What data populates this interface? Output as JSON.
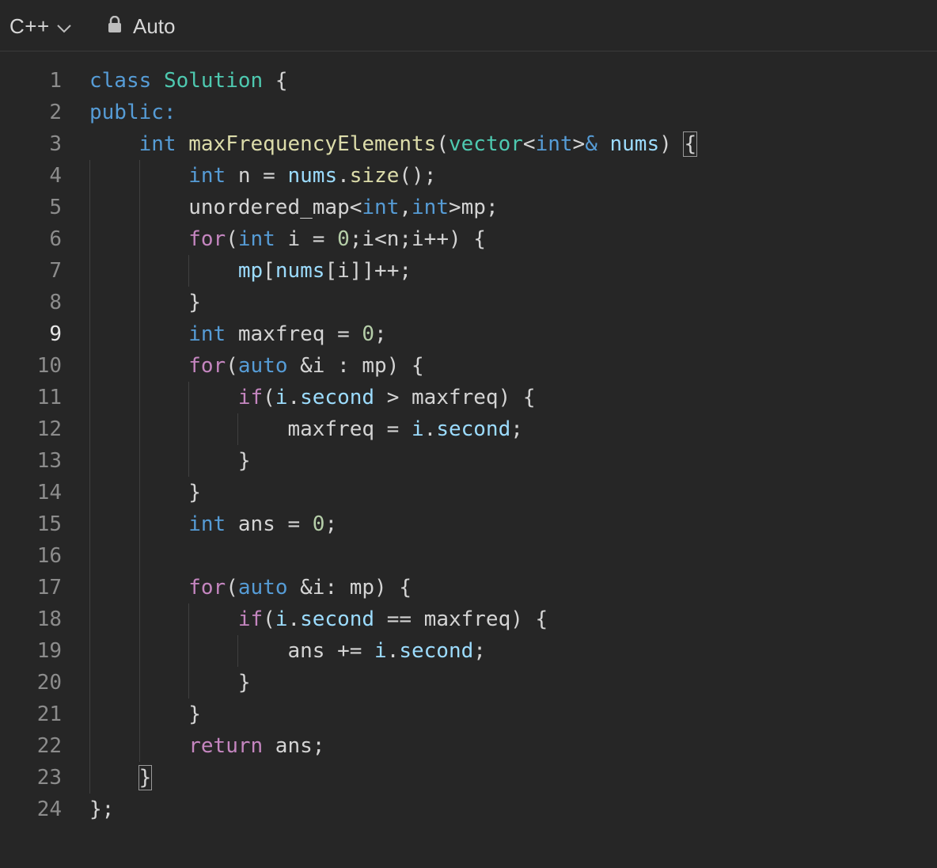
{
  "toolbar": {
    "language": "C++",
    "mode": "Auto",
    "icons": {
      "language_dropdown": "chevron-down-icon",
      "mode": "lock-icon"
    }
  },
  "editor": {
    "active_line": 9,
    "colors": {
      "background": "#262626",
      "keyword": "#569cd6",
      "control": "#c586c0",
      "type": "#4ec9b0",
      "function": "#dcdcaa",
      "variable": "#9cdcfe",
      "number": "#b5cea8",
      "text": "#d4d4d4"
    },
    "lines": [
      {
        "n": "1",
        "t": [
          [
            "class",
            "kw"
          ],
          [
            " ",
            ""
          ],
          [
            "Solution",
            "ty"
          ],
          [
            " {",
            ""
          ]
        ]
      },
      {
        "n": "2",
        "t": [
          [
            "public",
            "kw"
          ],
          [
            ":",
            "kw"
          ]
        ]
      },
      {
        "n": "3",
        "t": [
          [
            "    ",
            ""
          ],
          [
            "int",
            "kw"
          ],
          [
            " ",
            ""
          ],
          [
            "maxFrequencyElements",
            "fn"
          ],
          [
            "(",
            ""
          ],
          [
            "vector",
            "ty"
          ],
          [
            "<",
            ""
          ],
          [
            "int",
            "kw"
          ],
          [
            ">",
            ""
          ],
          [
            "&",
            "kw"
          ],
          [
            " ",
            ""
          ],
          [
            "nums",
            "var"
          ],
          [
            ") ",
            ""
          ],
          [
            "{",
            "bm"
          ]
        ]
      },
      {
        "n": "4",
        "t": [
          [
            "        ",
            ""
          ],
          [
            "int",
            "kw"
          ],
          [
            " n = ",
            ""
          ],
          [
            "nums",
            "var"
          ],
          [
            ".",
            ""
          ],
          [
            "size",
            "fn"
          ],
          [
            "();",
            ""
          ]
        ]
      },
      {
        "n": "5",
        "t": [
          [
            "        ",
            ""
          ],
          [
            "unordered_map<",
            ""
          ],
          [
            "int",
            "kw"
          ],
          [
            ",",
            ""
          ],
          [
            "int",
            "kw"
          ],
          [
            ">mp;",
            ""
          ]
        ]
      },
      {
        "n": "6",
        "t": [
          [
            "        ",
            ""
          ],
          [
            "for",
            "ctl"
          ],
          [
            "(",
            ""
          ],
          [
            "int",
            "kw"
          ],
          [
            " i = ",
            ""
          ],
          [
            "0",
            "num"
          ],
          [
            ";i<n;i++) {",
            ""
          ]
        ]
      },
      {
        "n": "7",
        "t": [
          [
            "            ",
            ""
          ],
          [
            "mp",
            "var"
          ],
          [
            "[",
            ""
          ],
          [
            "nums",
            "var"
          ],
          [
            "[i]]++;",
            ""
          ]
        ]
      },
      {
        "n": "8",
        "t": [
          [
            "        }",
            ""
          ]
        ]
      },
      {
        "n": "9",
        "t": [
          [
            "        ",
            ""
          ],
          [
            "int",
            "kw"
          ],
          [
            " maxfreq = ",
            ""
          ],
          [
            "0",
            "num"
          ],
          [
            ";",
            ""
          ]
        ]
      },
      {
        "n": "10",
        "t": [
          [
            "        ",
            ""
          ],
          [
            "for",
            "ctl"
          ],
          [
            "(",
            ""
          ],
          [
            "auto",
            "kw"
          ],
          [
            " &i : mp) {",
            ""
          ]
        ]
      },
      {
        "n": "11",
        "t": [
          [
            "            ",
            ""
          ],
          [
            "if",
            "ctl"
          ],
          [
            "(",
            ""
          ],
          [
            "i",
            "var"
          ],
          [
            ".",
            ""
          ],
          [
            "second",
            "var"
          ],
          [
            " > maxfreq) {",
            ""
          ]
        ]
      },
      {
        "n": "12",
        "t": [
          [
            "                maxfreq = ",
            ""
          ],
          [
            "i",
            "var"
          ],
          [
            ".",
            ""
          ],
          [
            "second",
            "var"
          ],
          [
            ";",
            ""
          ]
        ]
      },
      {
        "n": "13",
        "t": [
          [
            "            }",
            ""
          ]
        ]
      },
      {
        "n": "14",
        "t": [
          [
            "        }",
            ""
          ]
        ]
      },
      {
        "n": "15",
        "t": [
          [
            "        ",
            ""
          ],
          [
            "int",
            "kw"
          ],
          [
            " ans = ",
            ""
          ],
          [
            "0",
            "num"
          ],
          [
            ";",
            ""
          ]
        ]
      },
      {
        "n": "16",
        "t": []
      },
      {
        "n": "17",
        "t": [
          [
            "        ",
            ""
          ],
          [
            "for",
            "ctl"
          ],
          [
            "(",
            ""
          ],
          [
            "auto",
            "kw"
          ],
          [
            " &i: mp) {",
            ""
          ]
        ]
      },
      {
        "n": "18",
        "t": [
          [
            "            ",
            ""
          ],
          [
            "if",
            "ctl"
          ],
          [
            "(",
            ""
          ],
          [
            "i",
            "var"
          ],
          [
            ".",
            ""
          ],
          [
            "second",
            "var"
          ],
          [
            " == maxfreq) {",
            ""
          ]
        ]
      },
      {
        "n": "19",
        "t": [
          [
            "                ans += ",
            ""
          ],
          [
            "i",
            "var"
          ],
          [
            ".",
            ""
          ],
          [
            "second",
            "var"
          ],
          [
            ";",
            ""
          ]
        ]
      },
      {
        "n": "20",
        "t": [
          [
            "            }",
            ""
          ]
        ]
      },
      {
        "n": "21",
        "t": [
          [
            "        }",
            ""
          ]
        ]
      },
      {
        "n": "22",
        "t": [
          [
            "        ",
            ""
          ],
          [
            "return",
            "ctl"
          ],
          [
            " ans;",
            ""
          ]
        ]
      },
      {
        "n": "23",
        "t": [
          [
            "    ",
            ""
          ],
          [
            "}",
            "bm"
          ]
        ]
      },
      {
        "n": "24",
        "t": [
          [
            "};",
            ""
          ]
        ]
      }
    ]
  }
}
